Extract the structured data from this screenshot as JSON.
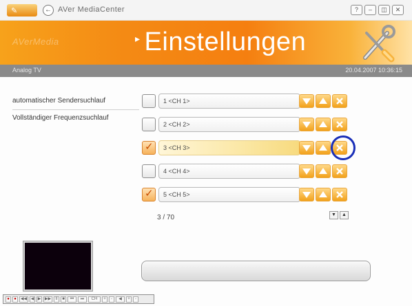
{
  "window": {
    "title": "AVer MediaCenter",
    "buttons": [
      "?",
      "–",
      "◫",
      "✕"
    ]
  },
  "banner": {
    "brand": "AVerMedia",
    "title": "Einstellungen",
    "icon": "tools-icon"
  },
  "status": {
    "source": "Analog TV",
    "datetime": "20.04.2007 10:36:15"
  },
  "menu": {
    "items": [
      "automatischer Sendersuchlauf",
      "Vollständiger Frequenzsuchlauf"
    ]
  },
  "channels": [
    {
      "label": "1 <CH 1>",
      "checked": false,
      "selected": false
    },
    {
      "label": "2 <CH 2>",
      "checked": false,
      "selected": false
    },
    {
      "label": "3 <CH 3>",
      "checked": true,
      "selected": true
    },
    {
      "label": "4 <CH 4>",
      "checked": false,
      "selected": false
    },
    {
      "label": "5 <CH 5>",
      "checked": true,
      "selected": false
    }
  ],
  "row_buttons": {
    "down_icon": "arrow-down-icon",
    "up_icon": "arrow-up-icon",
    "delete_icon": "delete-x-icon"
  },
  "list": {
    "count": "3 / 70",
    "page_down": "▼",
    "page_up": "▲"
  },
  "progress": {
    "value": 0.0
  },
  "controls": {
    "labels": [
      "●",
      "●",
      "◀◀",
      "◀",
      "▶",
      "▶▶",
      "II",
      "■",
      "⏮",
      "⏭",
      "CH",
      "+",
      "-",
      "◀",
      "+",
      "-"
    ]
  },
  "colors": {
    "accent": "#f48a14",
    "selection": "#fbe7a4",
    "highlight_ring": "#1a2fb8",
    "status_strip": "#8a8a8a"
  }
}
